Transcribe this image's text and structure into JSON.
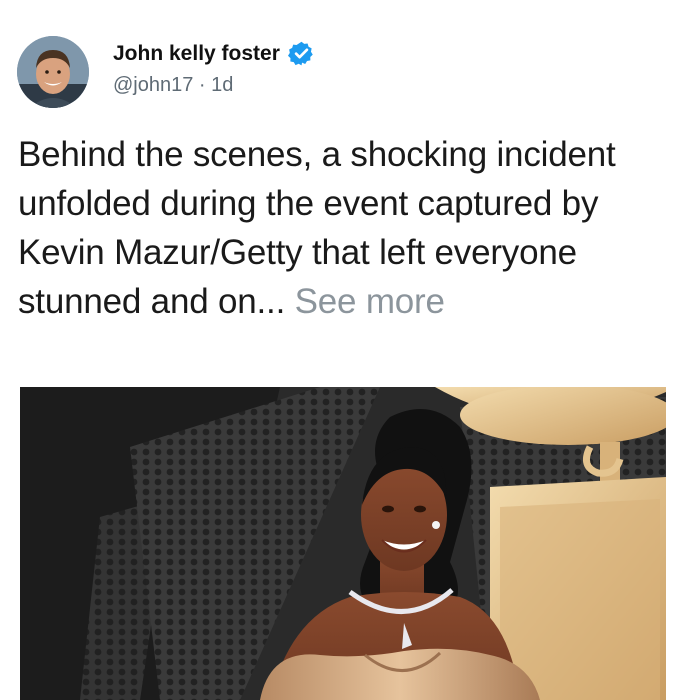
{
  "post": {
    "author_name": "John kelly foster",
    "handle": "@john17",
    "separator": " · ",
    "time": "1d",
    "text": "Behind the scenes, a shocking incident unfolded during the event captured by Kevin Mazur/Getty that left everyone stunned and on...",
    "see_more": "See more"
  },
  "icons": {
    "verified": "verified-badge-icon"
  },
  "colors": {
    "verified_blue": "#1d9bf0",
    "meta_gray": "#5f6b75",
    "see_more_gray": "#8c959c"
  }
}
